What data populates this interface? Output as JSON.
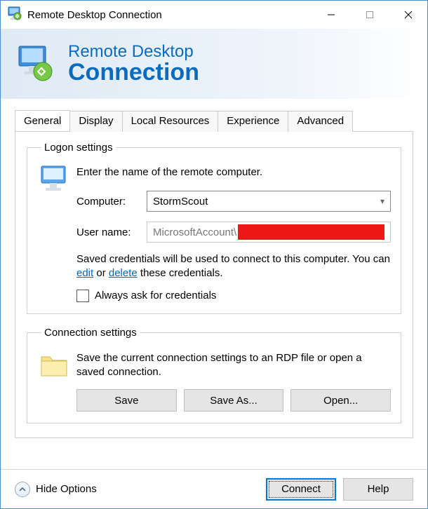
{
  "window": {
    "title": "Remote Desktop Connection"
  },
  "banner": {
    "line1": "Remote Desktop",
    "line2": "Connection"
  },
  "tabs": {
    "general": "General",
    "display": "Display",
    "local": "Local Resources",
    "experience": "Experience",
    "advanced": "Advanced"
  },
  "logon": {
    "legend": "Logon settings",
    "instruction": "Enter the name of the remote computer.",
    "computer_label": "Computer:",
    "computer_value": "StormScout",
    "user_label": "User name:",
    "user_value_prefix": "MicrosoftAccount\\",
    "saved_pre": "Saved credentials will be used to connect to this computer. You can ",
    "edit_link": "edit",
    "saved_mid": " or ",
    "delete_link": "delete",
    "saved_post": " these credentials.",
    "always_ask": "Always ask for credentials"
  },
  "conn": {
    "legend": "Connection settings",
    "text": "Save the current connection settings to an RDP file or open a saved connection.",
    "save": "Save",
    "save_as": "Save As...",
    "open": "Open..."
  },
  "footer": {
    "hide_options": "Hide Options",
    "connect": "Connect",
    "help": "Help"
  }
}
